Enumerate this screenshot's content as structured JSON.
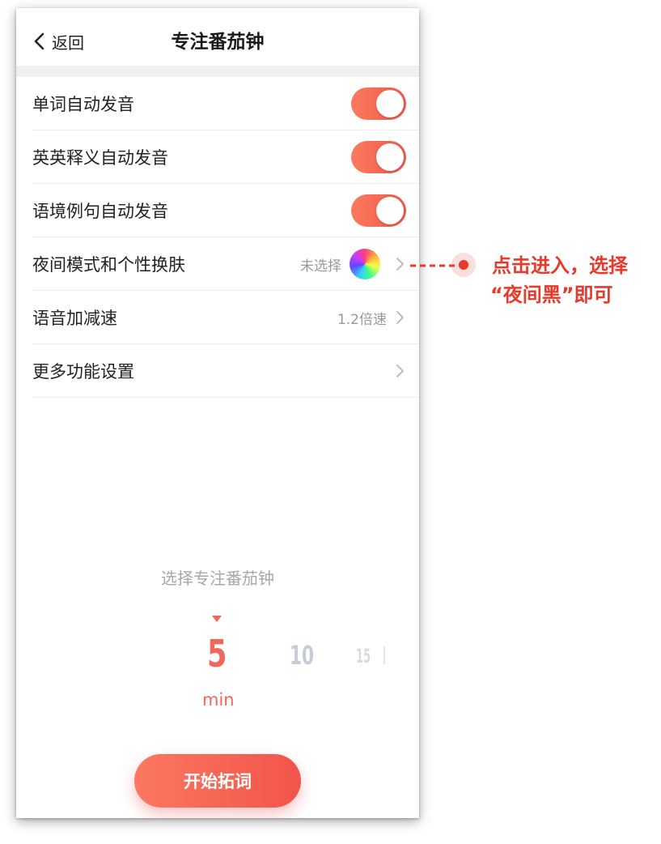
{
  "header": {
    "back_label": "返回",
    "title": "专注番茄钟"
  },
  "settings": [
    {
      "label": "单词自动发音",
      "toggle_on": true
    },
    {
      "label": "英英释义自动发音",
      "toggle_on": true
    },
    {
      "label": "语境例句自动发音",
      "toggle_on": true
    },
    {
      "label": "夜间模式和个性换肤",
      "value": "未选择",
      "icon": "color-wheel-icon"
    },
    {
      "label": "语音加减速",
      "value": "1.2倍速"
    },
    {
      "label": "更多功能设置"
    }
  ],
  "picker": {
    "title": "选择专注番茄钟",
    "options": [
      "5",
      "10",
      "15"
    ],
    "selected": "5",
    "unit": "min"
  },
  "start_button": "开始拓词",
  "annotation": {
    "line1": "点击进入，选择",
    "line2": "“夜间黑”即可"
  },
  "colors": {
    "accent": "#f4655a",
    "annotation": "#e8392b"
  }
}
